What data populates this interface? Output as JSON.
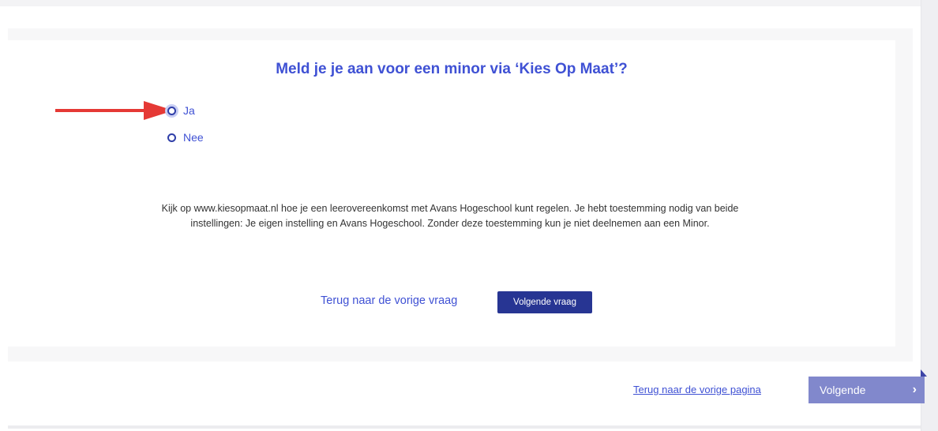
{
  "question": {
    "title": "Meld je je aan voor een minor via ‘Kies Op Maat’?",
    "options": [
      {
        "label": "Ja"
      },
      {
        "label": "Nee"
      }
    ],
    "info_text": "Kijk op www.kiesopmaat.nl hoe je een leerovereenkomst met Avans Hogeschool kunt regelen. Je hebt toestemming nodig van beide instellingen: Je eigen instelling en Avans Hogeschool. Zonder deze toestemming kun je niet deelnemen aan een Minor.",
    "prev_label": "Terug naar de vorige vraag",
    "next_label": "Volgende vraag"
  },
  "footer": {
    "prev_page_label": "Terug naar de vorige pagina",
    "next_page_label": "Volgende",
    "next_page_chevron": "›"
  },
  "colors": {
    "accent": "#3f51d4",
    "dark_button": "#273593",
    "next_page_button": "#8188cc",
    "arrow": "#e53935"
  },
  "icons": {
    "pointer_arrow": "red-arrow-icon",
    "next_chevron": "chevron-right-icon"
  }
}
